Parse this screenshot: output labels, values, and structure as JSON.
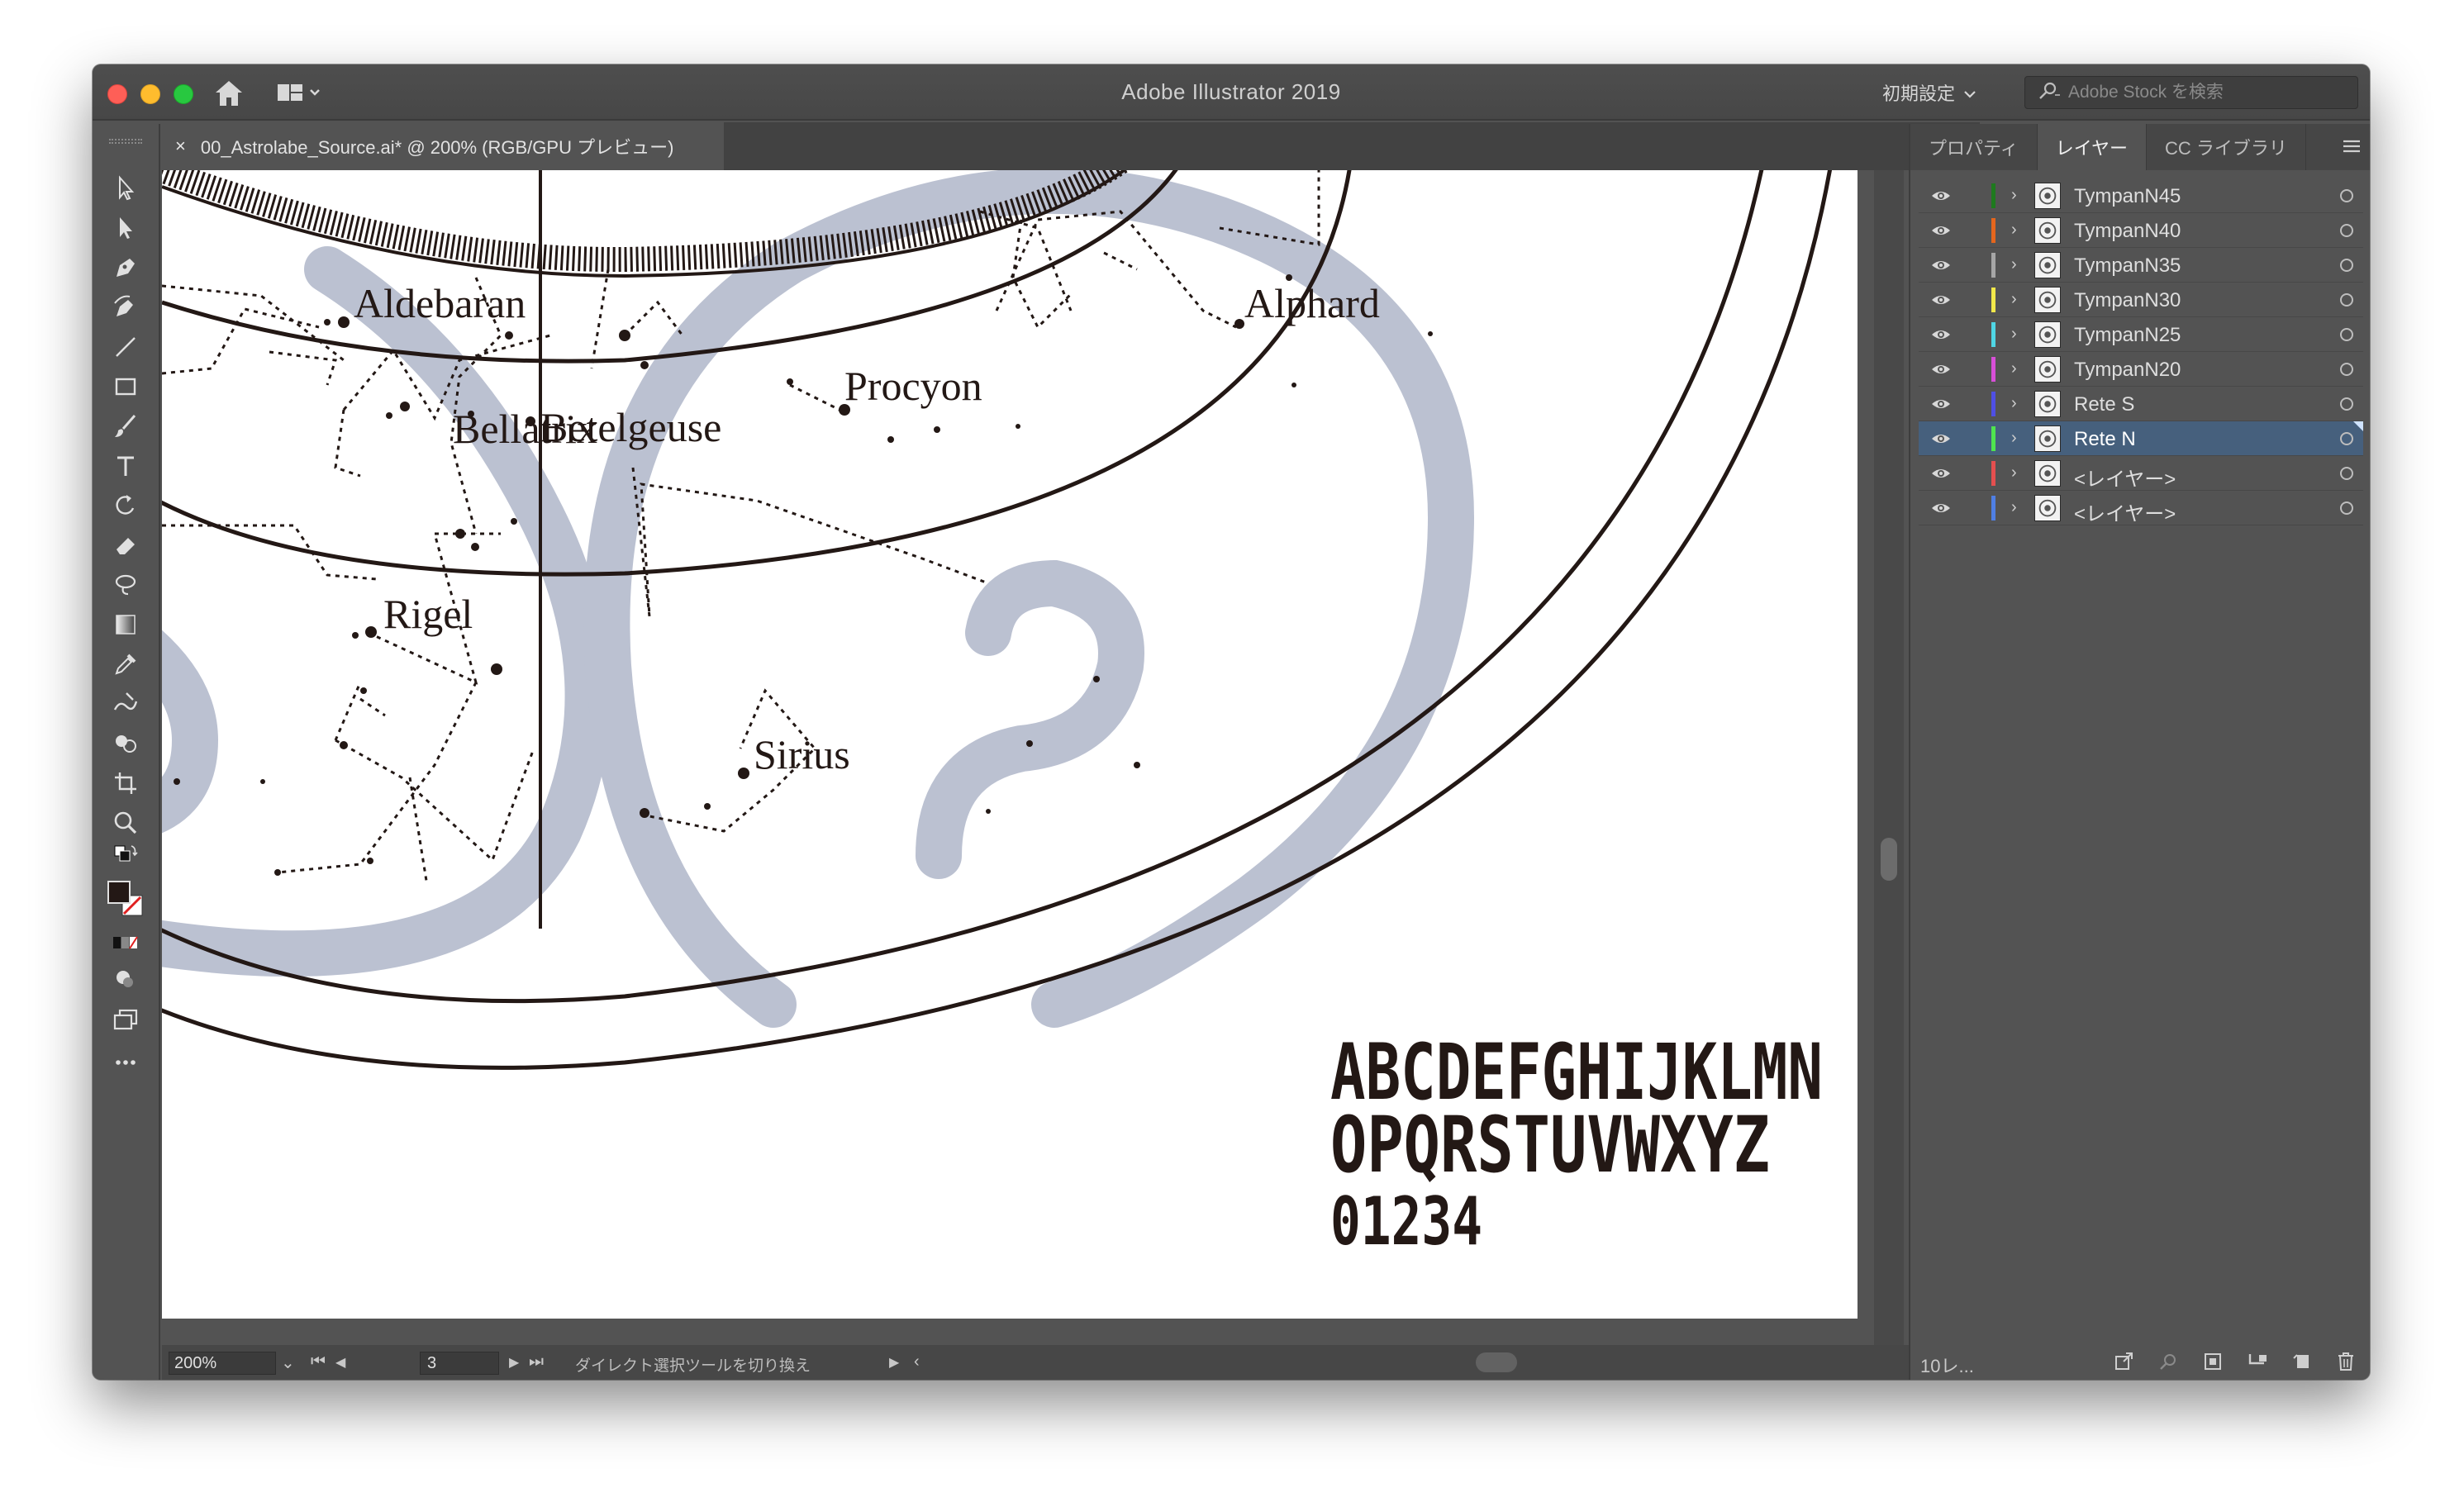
{
  "app": {
    "title": "Adobe Illustrator 2019",
    "workspace": "初期設定",
    "stock_placeholder": "Adobe Stock を検索"
  },
  "document": {
    "tab_title": "00_Astrolabe_Source.ai* @ 200% (RGB/GPU プレビュー)",
    "close_glyph": "×"
  },
  "artwork": {
    "star_labels": [
      "Aldebaran",
      "Alphard",
      "Procyon",
      "Bellatrix",
      "Betelgeuse",
      "Rigel",
      "Sirius"
    ],
    "font_sample": [
      "ABCDEFGHIJKLMN",
      "OPQRSTUVWXYZ",
      "01234"
    ],
    "ornament_color": "#bbc1d1"
  },
  "status": {
    "zoom": "200%",
    "page": "3",
    "tool_hint": "ダイレクト選択ツールを切り換え"
  },
  "panel": {
    "tabs": [
      "プロパティ",
      "レイヤー",
      "CC ライブラリ"
    ],
    "active_tab": "レイヤー",
    "layers": [
      {
        "name": "TympanN45",
        "color": "#1e7a1e",
        "selected": false
      },
      {
        "name": "TympanN40",
        "color": "#e4661d",
        "selected": false
      },
      {
        "name": "TympanN35",
        "color": "#a6a6a6",
        "selected": false
      },
      {
        "name": "TympanN30",
        "color": "#f2e84a",
        "selected": false
      },
      {
        "name": "TympanN25",
        "color": "#4fd6e4",
        "selected": false
      },
      {
        "name": "TympanN20",
        "color": "#d84fd8",
        "selected": false
      },
      {
        "name": "Rete S",
        "color": "#4f4fe4",
        "selected": false
      },
      {
        "name": "Rete N",
        "color": "#4fe44f",
        "selected": true
      },
      {
        "name": "<レイヤー>",
        "color": "#e44f4f",
        "selected": false
      },
      {
        "name": "<レイヤー>",
        "color": "#4f7fe4",
        "selected": false
      }
    ],
    "layer_count": "10レ..."
  },
  "tools": [
    "selection-tool",
    "direct-selection-tool",
    "pen-tool",
    "curvature-tool",
    "line-tool",
    "rectangle-tool",
    "paintbrush-tool",
    "type-tool",
    "rotate-tool",
    "eraser-tool",
    "lasso-tool",
    "gradient-tool",
    "eyedropper-tool",
    "blend-tool",
    "shape-builder-tool",
    "artboard-tool",
    "zoom-tool"
  ]
}
